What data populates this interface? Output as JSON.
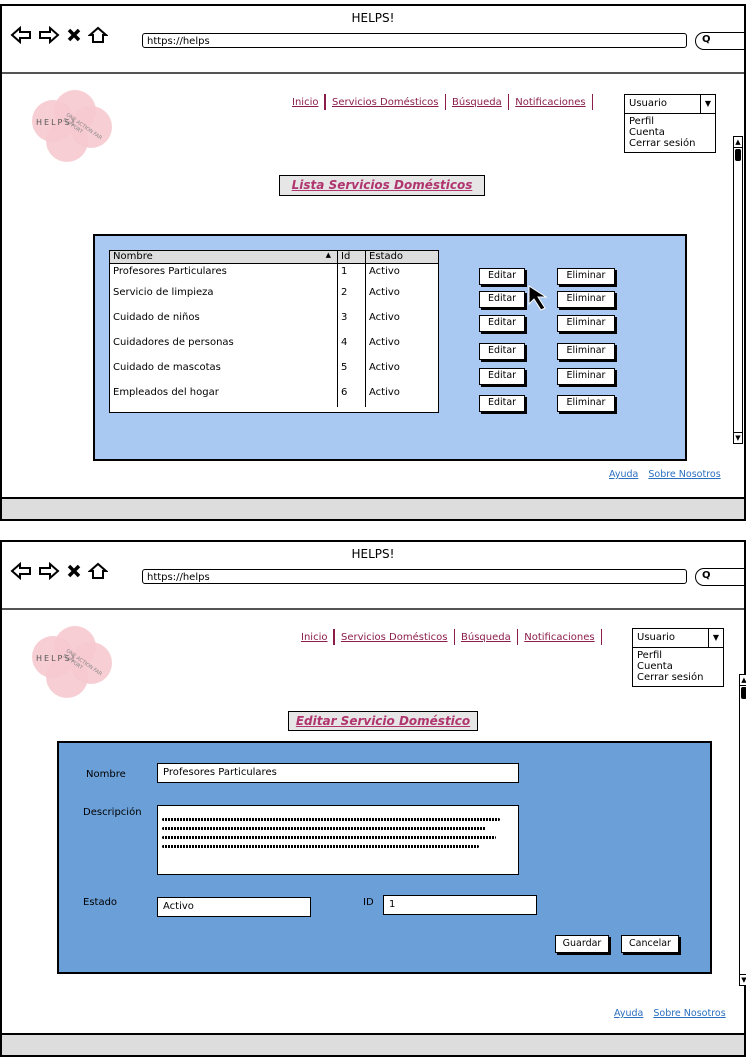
{
  "browser": {
    "title": "HELPS!",
    "url": "https://helps"
  },
  "logo": {
    "text": "HELPS!",
    "tagline": "ONE ACTION FAR SUPPORT"
  },
  "nav": {
    "items": [
      "Inicio",
      "Servicios Domésticos",
      "Búsqueda",
      "Notificaciones"
    ]
  },
  "user_menu": {
    "selected": "Usuario",
    "options": [
      "Perfil",
      "Cuenta",
      "Cerrar sesión"
    ]
  },
  "screen1": {
    "page_title": "Lista Servicios Domésticos",
    "columns": [
      "Nombre",
      "Id",
      "Estado"
    ],
    "rows": [
      {
        "nombre": "Profesores Particulares",
        "id": "1",
        "estado": "Activo"
      },
      {
        "nombre": "Servicio de limpieza",
        "id": "2",
        "estado": "Activo"
      },
      {
        "nombre": "Cuidado de niños",
        "id": "3",
        "estado": "Activo"
      },
      {
        "nombre": "Cuidadores de personas",
        "id": "4",
        "estado": "Activo"
      },
      {
        "nombre": "Cuidado de mascotas",
        "id": "5",
        "estado": "Activo"
      },
      {
        "nombre": "Empleados del hogar",
        "id": "6",
        "estado": "Activo"
      }
    ],
    "edit_label": "Editar",
    "delete_label": "Eliminar",
    "panel_color": "#a9c8f2"
  },
  "screen2": {
    "page_title": "Editar Servicio Doméstico",
    "name_label": "Nombre",
    "name_value": "Profesores Particulares",
    "desc_label": "Descripción",
    "state_label": "Estado",
    "state_value": "Activo",
    "id_label": "ID",
    "id_value": "1",
    "save_label": "Guardar",
    "cancel_label": "Cancelar",
    "panel_color": "#6b9fd8"
  },
  "footer_links": {
    "help": "Ayuda",
    "about": "Sobre Nosotros"
  },
  "colors": {
    "nav_link": "#8b1d4a",
    "title_text": "#b0346d",
    "footer_link": "#2a6fbf",
    "logo_pink": "#f6c9cf"
  }
}
